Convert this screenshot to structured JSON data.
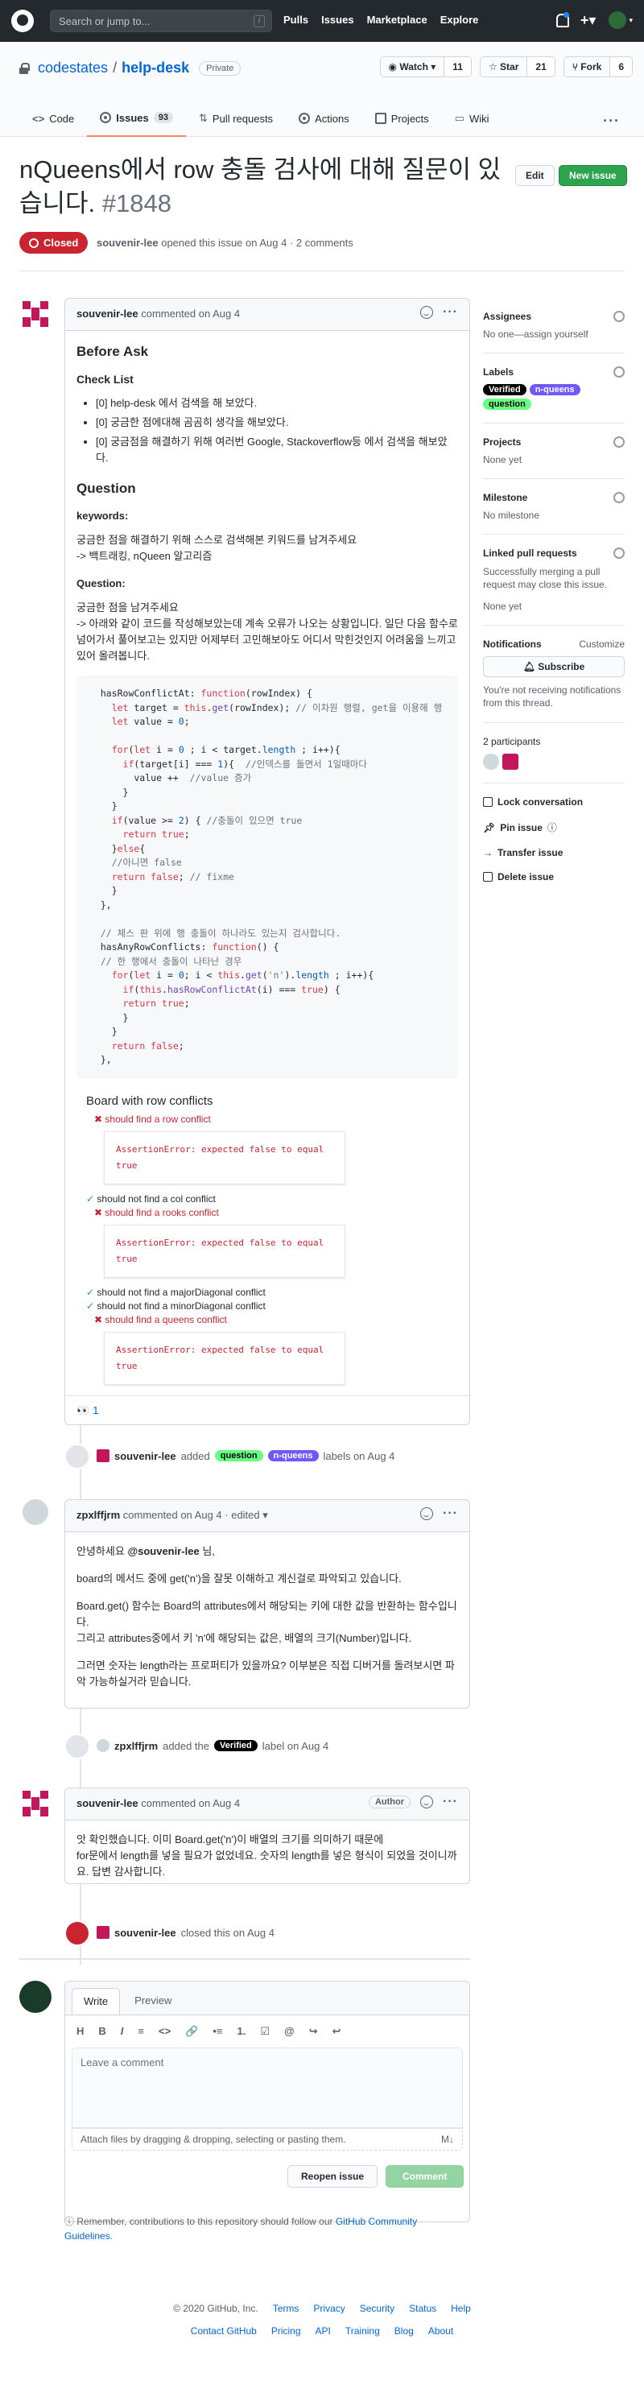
{
  "header": {
    "search_placeholder": "Search or jump to...",
    "slash": "/",
    "nav": [
      "Pulls",
      "Issues",
      "Marketplace",
      "Explore"
    ]
  },
  "repo": {
    "owner": "codestates",
    "sep": "/",
    "name": "help-desk",
    "visibility": "Private",
    "watch_label": "Watch",
    "watch_count": "11",
    "star_label": "Star",
    "star_count": "21",
    "fork_label": "Fork",
    "fork_count": "6"
  },
  "tabs": [
    {
      "label": "Code"
    },
    {
      "label": "Issues",
      "count": "93"
    },
    {
      "label": "Pull requests"
    },
    {
      "label": "Actions"
    },
    {
      "label": "Projects"
    },
    {
      "label": "Wiki"
    }
  ],
  "issue": {
    "title": "nQueens에서 row 충돌 검사에 대해 질문이 있습니다.",
    "number": "#1848",
    "edit_label": "Edit",
    "new_label": "New issue",
    "state": "Closed",
    "author": "souvenir-lee",
    "meta": "opened this issue on Aug 4 · 2 comments"
  },
  "comment1": {
    "author": "souvenir-lee",
    "time": "commented on Aug 4",
    "h_before": "Before Ask",
    "h_check": "Check List",
    "checks": [
      "[0] help-desk 에서 검색을 해 보았다.",
      "[0] 궁금한 점에대해 곰곰히 생각을 해보았다.",
      "[0] 궁금점을 해결하기 위해 여러번 Google, Stackoverflow등 에서 검색을 해보았다."
    ],
    "h_question": "Question",
    "h_keywords": "keywords:",
    "keywords_1": "궁금한 점을 해결하기 위해 스스로 검색해본 키워드를 남겨주세요",
    "keywords_2": "-> 백트래킹, nQueen 알고리즘",
    "h_q2": "Question:",
    "q_1": "궁금한 점을 남겨주세요",
    "q_2": "-> 아래와 같이 코드를 작성해보았는데 계속 오류가 나오는 상황입니다. 일단 다음 함수로 넘어가서 풀어보고는 있지만 어제부터 고민해보아도 어디서 막힌것인지 어려움을 느끼고 있어 올려봅니다.",
    "tests_title": "Board with row conflicts",
    "tests": [
      {
        "status": "fail",
        "text": "should find a row conflict",
        "error": "AssertionError: expected false to equal true"
      },
      {
        "status": "pass",
        "text": "should not find a col conflict"
      },
      {
        "status": "fail",
        "text": "should find a rooks conflict",
        "error": "AssertionError: expected false to equal true"
      },
      {
        "status": "pass",
        "text": "should not find a majorDiagonal conflict"
      },
      {
        "status": "pass",
        "text": "should not find a minorDiagonal conflict"
      },
      {
        "status": "fail",
        "text": "should find a queens conflict",
        "error": "AssertionError: expected false to equal true"
      }
    ],
    "reaction_emoji": "👀",
    "reaction_count": "1"
  },
  "event1": {
    "actor": "souvenir-lee",
    "text": "added",
    "labels": [
      "question",
      "n-queens"
    ],
    "suffix": "labels on Aug 4"
  },
  "comment2": {
    "author": "zpxlffjrm",
    "time": "commented on Aug 4 · edited",
    "greeting_pre": "안녕하세요",
    "mention": "@souvenir-lee",
    "greeting_post": "님,",
    "p1": "board의 메서드 중에 get('n')을 잘못 이해하고 계신걸로 파악되고 있습니다.",
    "p2": "Board.get() 함수는 Board의 attributes에서 해당되는 키에 대한 값을 반환하는 함수입니다.",
    "p3": "그리고 attributes중에서 키 'n'에 해당되는 값은, 배열의 크기(Number)입니다.",
    "p4": "그러면 숫자는 length라는 프로퍼티가 있을까요? 이부분은 직접 디버거를 돌려보시면 파악 가능하실거라 믿습니다."
  },
  "event2": {
    "actor": "zpxlffjrm",
    "text": "added the",
    "label": "Verified",
    "suffix": "label on Aug 4"
  },
  "comment3": {
    "author": "souvenir-lee",
    "time": "commented on Aug 4",
    "badge": "Author",
    "p1": "앗 확인했습니다. 이미 Board.get('n')이 배열의 크기를 의미하기 때문에",
    "p2": "for문에서 length를 넣을 필요가 없었네요. 숫자의 length를 넣은 형식이 되었을 것이니까요. 답변 감사합니다."
  },
  "event3": {
    "actor": "souvenir-lee",
    "text": "closed this on Aug 4"
  },
  "sidebar": {
    "assignees_h": "Assignees",
    "assignees_v": "No one—assign yourself",
    "labels_h": "Labels",
    "labels": [
      "Verified",
      "n-queens",
      "question"
    ],
    "projects_h": "Projects",
    "projects_v": "None yet",
    "milestone_h": "Milestone",
    "milestone_v": "No milestone",
    "linked_h": "Linked pull requests",
    "linked_desc": "Successfully merging a pull request may close this issue.",
    "linked_v": "None yet",
    "notif_h": "Notifications",
    "notif_customize": "Customize",
    "subscribe": "Subscribe",
    "notif_desc": "You're not receiving notifications from this thread.",
    "participants": "2 participants",
    "lock": "Lock conversation",
    "pin": "Pin issue",
    "transfer": "Transfer issue",
    "delete": "Delete issue"
  },
  "newcomment": {
    "write": "Write",
    "preview": "Preview",
    "placeholder": "Leave a comment",
    "attach": "Attach files by dragging & dropping, selecting or pasting them.",
    "reopen": "Reopen issue",
    "comment": "Comment",
    "tools": [
      "H",
      "B",
      "I",
      "≡",
      "<>",
      "🔗",
      "•≡",
      "1.",
      "☑",
      "@",
      "↪",
      "↩"
    ]
  },
  "remember": {
    "text": "Remember, contributions to this repository should follow our",
    "link": "GitHub Community Guidelines",
    "end": "."
  },
  "footer": {
    "copyright": "© 2020 GitHub, Inc.",
    "row1": [
      "Terms",
      "Privacy",
      "Security",
      "Status",
      "Help"
    ],
    "row2": [
      "Contact GitHub",
      "Pricing",
      "API",
      "Training",
      "Blog",
      "About"
    ]
  }
}
